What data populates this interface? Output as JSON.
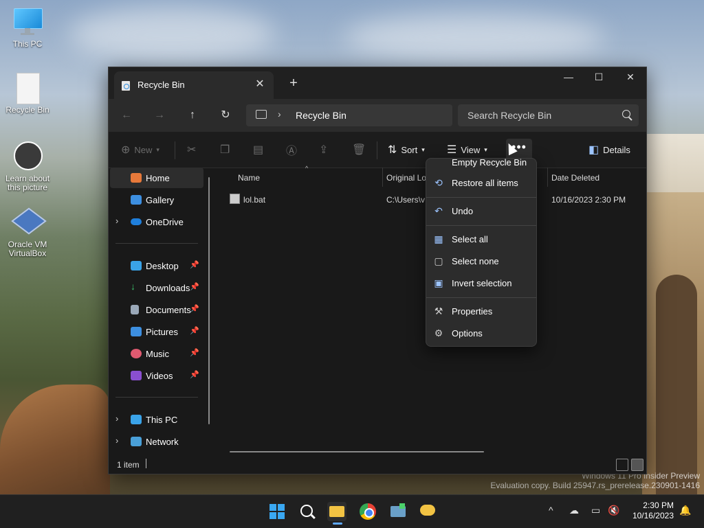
{
  "desktop": {
    "icons": [
      {
        "label": "This PC"
      },
      {
        "label": "Recycle Bin"
      },
      {
        "label": "Learn about this picture"
      },
      {
        "label": "Oracle VM VirtualBox"
      }
    ],
    "watermark_line1": "Windows 11 Pro Insider Preview",
    "watermark_line2": "Evaluation copy. Build 25947.rs_prerelease.230901-1416"
  },
  "window": {
    "tab_title": "Recycle Bin",
    "tab_close": "✕",
    "new_tab": "+",
    "controls": {
      "minimize": "—",
      "maximize": "☐",
      "close": "✕"
    },
    "nav": {
      "back": "←",
      "forward": "→",
      "up": "↑",
      "refresh": "↻"
    },
    "breadcrumb": "Recycle Bin",
    "search_placeholder": "Search Recycle Bin",
    "toolbar": {
      "new_label": "New",
      "sort_label": "Sort",
      "view_label": "View",
      "more_label": "•••",
      "details_label": "Details"
    },
    "sidebar": {
      "home": "Home",
      "gallery": "Gallery",
      "onedrive": "OneDrive",
      "desktop": "Desktop",
      "downloads": "Downloads",
      "documents": "Documents",
      "pictures": "Pictures",
      "music": "Music",
      "videos": "Videos",
      "thispc": "This PC",
      "network": "Network"
    },
    "columns": {
      "name": "Name",
      "original_location": "Original Lo",
      "date_deleted": "Date Deleted"
    },
    "rows": [
      {
        "name": "lol.bat",
        "original_location": "C:\\Users\\v",
        "date_deleted": "10/16/2023 2:30 PM"
      }
    ],
    "status": "1 item"
  },
  "context_menu": {
    "empty": "Empty Recycle Bin",
    "restore_all": "Restore all items",
    "undo": "Undo",
    "select_all": "Select all",
    "select_none": "Select none",
    "invert": "Invert selection",
    "properties": "Properties",
    "options": "Options"
  },
  "taskbar": {
    "time": "2:30 PM",
    "date": "10/16/2023"
  },
  "colors": {
    "window_bg": "#191919",
    "accent": "#9cc4ff",
    "taskbar_bg": "#202020"
  }
}
